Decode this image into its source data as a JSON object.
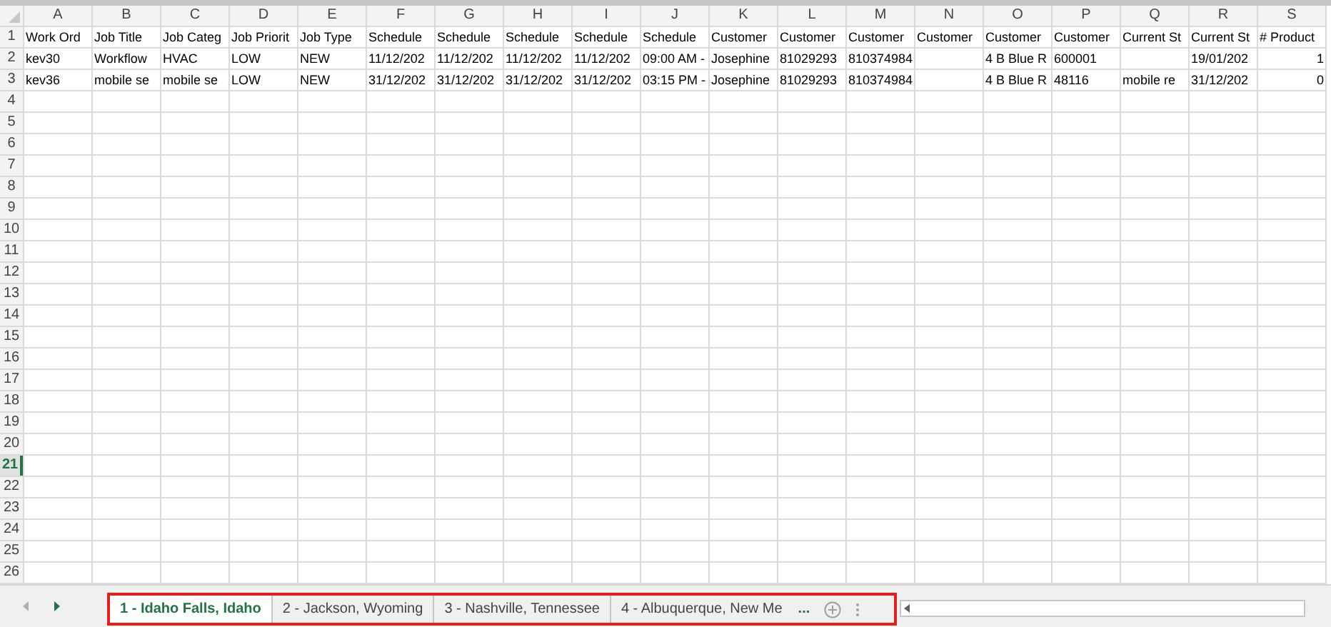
{
  "columns": [
    "A",
    "B",
    "C",
    "D",
    "E",
    "F",
    "G",
    "H",
    "I",
    "J",
    "K",
    "L",
    "M",
    "N",
    "O",
    "P",
    "Q",
    "R",
    "S"
  ],
  "rows": [
    {
      "number": "1",
      "selected": false,
      "cells": [
        "Work Ord",
        "Job Title",
        "Job Categ",
        "Job Priorit",
        "Job Type",
        "Schedule",
        "Schedule",
        "Schedule",
        "Schedule",
        "Schedule",
        "Customer",
        "Customer",
        "Customer",
        "Customer",
        "Customer",
        "Customer",
        "Current St",
        "Current St",
        "# Product"
      ]
    },
    {
      "number": "2",
      "selected": false,
      "cells": [
        "kev30",
        "Workflow",
        "HVAC",
        "LOW",
        "NEW",
        "11/12/202",
        "11/12/202",
        "11/12/202",
        "11/12/202",
        "09:00 AM -",
        "Josephine",
        "81029293",
        "810374984",
        "",
        "4 B Blue R",
        "600001",
        "",
        "19/01/202",
        "1"
      ]
    },
    {
      "number": "3",
      "selected": false,
      "cells": [
        "kev36",
        "mobile se",
        "mobile se",
        "LOW",
        "NEW",
        "31/12/202",
        "31/12/202",
        "31/12/202",
        "31/12/202",
        "03:15 PM -",
        "Josephine",
        "81029293",
        "810374984",
        "",
        "4 B Blue R",
        "48116",
        "mobile re",
        "31/12/202",
        "0"
      ]
    },
    {
      "number": "4",
      "selected": false
    },
    {
      "number": "5",
      "selected": false
    },
    {
      "number": "6",
      "selected": false
    },
    {
      "number": "7",
      "selected": false
    },
    {
      "number": "8",
      "selected": false
    },
    {
      "number": "9",
      "selected": false
    },
    {
      "number": "10",
      "selected": false
    },
    {
      "number": "11",
      "selected": false
    },
    {
      "number": "12",
      "selected": false
    },
    {
      "number": "13",
      "selected": false
    },
    {
      "number": "14",
      "selected": false
    },
    {
      "number": "15",
      "selected": false
    },
    {
      "number": "16",
      "selected": false
    },
    {
      "number": "17",
      "selected": false
    },
    {
      "number": "18",
      "selected": false
    },
    {
      "number": "19",
      "selected": false
    },
    {
      "number": "20",
      "selected": false
    },
    {
      "number": "21",
      "selected": true
    },
    {
      "number": "22",
      "selected": false
    },
    {
      "number": "23",
      "selected": false
    },
    {
      "number": "24",
      "selected": false
    },
    {
      "number": "25",
      "selected": false
    },
    {
      "number": "26",
      "selected": false
    }
  ],
  "sheet_tabs": [
    {
      "label": "1 - Idaho Falls, Idaho",
      "selected": true
    },
    {
      "label": "2 - Jackson, Wyoming",
      "selected": false
    },
    {
      "label": "3 - Nashville, Tennessee",
      "selected": false
    },
    {
      "label": "4 - Albuquerque, New Me",
      "selected": false
    }
  ],
  "more_tabs": "..."
}
